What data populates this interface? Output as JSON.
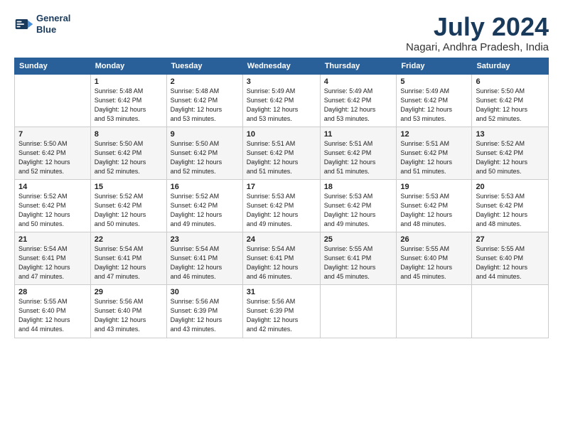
{
  "logo": {
    "line1": "General",
    "line2": "Blue"
  },
  "title": {
    "month_year": "July 2024",
    "location": "Nagari, Andhra Pradesh, India"
  },
  "weekdays": [
    "Sunday",
    "Monday",
    "Tuesday",
    "Wednesday",
    "Thursday",
    "Friday",
    "Saturday"
  ],
  "weeks": [
    [
      {
        "day": "",
        "info": ""
      },
      {
        "day": "1",
        "info": "Sunrise: 5:48 AM\nSunset: 6:42 PM\nDaylight: 12 hours\nand 53 minutes."
      },
      {
        "day": "2",
        "info": "Sunrise: 5:48 AM\nSunset: 6:42 PM\nDaylight: 12 hours\nand 53 minutes."
      },
      {
        "day": "3",
        "info": "Sunrise: 5:49 AM\nSunset: 6:42 PM\nDaylight: 12 hours\nand 53 minutes."
      },
      {
        "day": "4",
        "info": "Sunrise: 5:49 AM\nSunset: 6:42 PM\nDaylight: 12 hours\nand 53 minutes."
      },
      {
        "day": "5",
        "info": "Sunrise: 5:49 AM\nSunset: 6:42 PM\nDaylight: 12 hours\nand 53 minutes."
      },
      {
        "day": "6",
        "info": "Sunrise: 5:50 AM\nSunset: 6:42 PM\nDaylight: 12 hours\nand 52 minutes."
      }
    ],
    [
      {
        "day": "7",
        "info": "Sunrise: 5:50 AM\nSunset: 6:42 PM\nDaylight: 12 hours\nand 52 minutes."
      },
      {
        "day": "8",
        "info": "Sunrise: 5:50 AM\nSunset: 6:42 PM\nDaylight: 12 hours\nand 52 minutes."
      },
      {
        "day": "9",
        "info": "Sunrise: 5:50 AM\nSunset: 6:42 PM\nDaylight: 12 hours\nand 52 minutes."
      },
      {
        "day": "10",
        "info": "Sunrise: 5:51 AM\nSunset: 6:42 PM\nDaylight: 12 hours\nand 51 minutes."
      },
      {
        "day": "11",
        "info": "Sunrise: 5:51 AM\nSunset: 6:42 PM\nDaylight: 12 hours\nand 51 minutes."
      },
      {
        "day": "12",
        "info": "Sunrise: 5:51 AM\nSunset: 6:42 PM\nDaylight: 12 hours\nand 51 minutes."
      },
      {
        "day": "13",
        "info": "Sunrise: 5:52 AM\nSunset: 6:42 PM\nDaylight: 12 hours\nand 50 minutes."
      }
    ],
    [
      {
        "day": "14",
        "info": "Sunrise: 5:52 AM\nSunset: 6:42 PM\nDaylight: 12 hours\nand 50 minutes."
      },
      {
        "day": "15",
        "info": "Sunrise: 5:52 AM\nSunset: 6:42 PM\nDaylight: 12 hours\nand 50 minutes."
      },
      {
        "day": "16",
        "info": "Sunrise: 5:52 AM\nSunset: 6:42 PM\nDaylight: 12 hours\nand 49 minutes."
      },
      {
        "day": "17",
        "info": "Sunrise: 5:53 AM\nSunset: 6:42 PM\nDaylight: 12 hours\nand 49 minutes."
      },
      {
        "day": "18",
        "info": "Sunrise: 5:53 AM\nSunset: 6:42 PM\nDaylight: 12 hours\nand 49 minutes."
      },
      {
        "day": "19",
        "info": "Sunrise: 5:53 AM\nSunset: 6:42 PM\nDaylight: 12 hours\nand 48 minutes."
      },
      {
        "day": "20",
        "info": "Sunrise: 5:53 AM\nSunset: 6:42 PM\nDaylight: 12 hours\nand 48 minutes."
      }
    ],
    [
      {
        "day": "21",
        "info": "Sunrise: 5:54 AM\nSunset: 6:41 PM\nDaylight: 12 hours\nand 47 minutes."
      },
      {
        "day": "22",
        "info": "Sunrise: 5:54 AM\nSunset: 6:41 PM\nDaylight: 12 hours\nand 47 minutes."
      },
      {
        "day": "23",
        "info": "Sunrise: 5:54 AM\nSunset: 6:41 PM\nDaylight: 12 hours\nand 46 minutes."
      },
      {
        "day": "24",
        "info": "Sunrise: 5:54 AM\nSunset: 6:41 PM\nDaylight: 12 hours\nand 46 minutes."
      },
      {
        "day": "25",
        "info": "Sunrise: 5:55 AM\nSunset: 6:41 PM\nDaylight: 12 hours\nand 45 minutes."
      },
      {
        "day": "26",
        "info": "Sunrise: 5:55 AM\nSunset: 6:40 PM\nDaylight: 12 hours\nand 45 minutes."
      },
      {
        "day": "27",
        "info": "Sunrise: 5:55 AM\nSunset: 6:40 PM\nDaylight: 12 hours\nand 44 minutes."
      }
    ],
    [
      {
        "day": "28",
        "info": "Sunrise: 5:55 AM\nSunset: 6:40 PM\nDaylight: 12 hours\nand 44 minutes."
      },
      {
        "day": "29",
        "info": "Sunrise: 5:56 AM\nSunset: 6:40 PM\nDaylight: 12 hours\nand 43 minutes."
      },
      {
        "day": "30",
        "info": "Sunrise: 5:56 AM\nSunset: 6:39 PM\nDaylight: 12 hours\nand 43 minutes."
      },
      {
        "day": "31",
        "info": "Sunrise: 5:56 AM\nSunset: 6:39 PM\nDaylight: 12 hours\nand 42 minutes."
      },
      {
        "day": "",
        "info": ""
      },
      {
        "day": "",
        "info": ""
      },
      {
        "day": "",
        "info": ""
      }
    ]
  ]
}
